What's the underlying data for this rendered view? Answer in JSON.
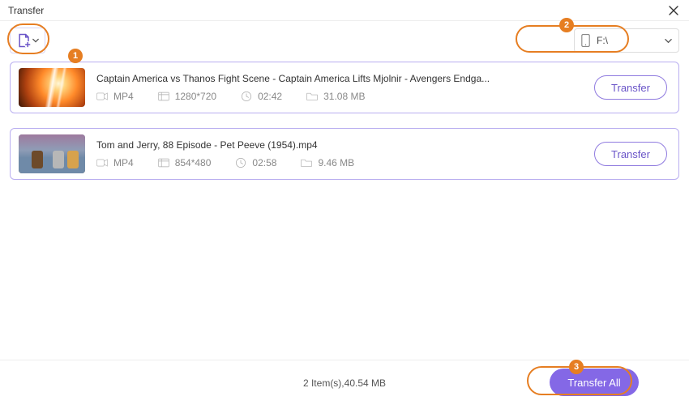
{
  "window": {
    "title": "Transfer"
  },
  "toolbar": {
    "add_icon": "file-add-icon",
    "destination": {
      "label": "F:\\",
      "icon": "device-phone-icon"
    }
  },
  "items": [
    {
      "title": "Captain America vs Thanos Fight Scene - Captain America Lifts Mjolnir - Avengers Endga...",
      "format": "MP4",
      "resolution": "1280*720",
      "duration": "02:42",
      "size": "31.08 MB",
      "action": "Transfer"
    },
    {
      "title": "Tom and Jerry, 88 Episode - Pet Peeve (1954).mp4",
      "format": "MP4",
      "resolution": "854*480",
      "duration": "02:58",
      "size": "9.46 MB",
      "action": "Transfer"
    }
  ],
  "footer": {
    "summary": "2 Item(s),40.54 MB",
    "transfer_all": "Transfer All"
  },
  "annotations": {
    "step1": "1",
    "step2": "2",
    "step3": "3"
  }
}
